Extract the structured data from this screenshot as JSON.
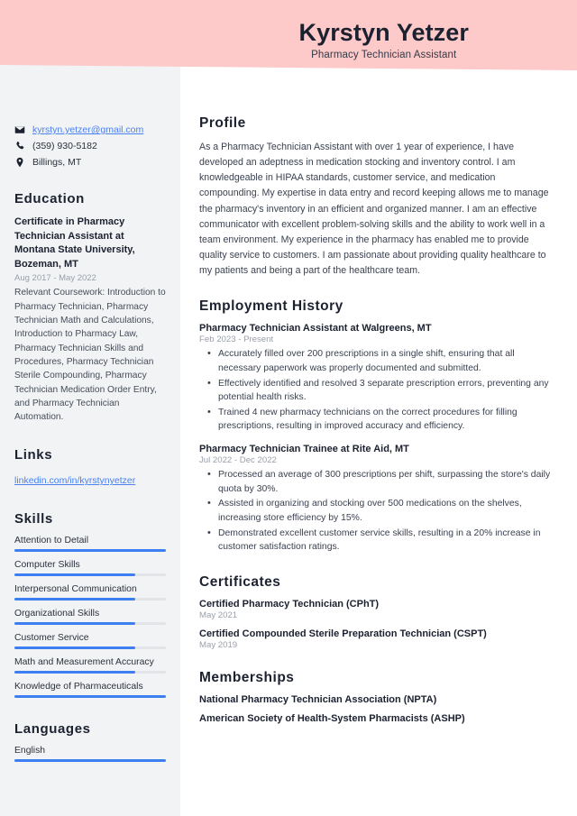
{
  "theme": {
    "banner_color": "#fdc9c9",
    "sidebar_color": "#f1f3f5",
    "accent_color": "#3d7ff0",
    "link_color": "#4a80f0"
  },
  "header": {
    "name": "Kyrstyn Yetzer",
    "job_title": "Pharmacy Technician Assistant"
  },
  "contact": {
    "email": "kyrstyn.yetzer@gmail.com",
    "phone": "(359) 930-5182",
    "location": "Billings, MT"
  },
  "education": {
    "heading": "Education",
    "entries": [
      {
        "title": "Certificate in Pharmacy Technician Assistant at Montana State University, Bozeman, MT",
        "date": "Aug 2017 - May 2022",
        "description": "Relevant Coursework: Introduction to Pharmacy Technician, Pharmacy Technician Math and Calculations, Introduction to Pharmacy Law, Pharmacy Technician Skills and Procedures, Pharmacy Technician Sterile Compounding, Pharmacy Technician Medication Order Entry, and Pharmacy Technician Automation."
      }
    ]
  },
  "links": {
    "heading": "Links",
    "items": [
      {
        "label": "linkedin.com/in/kyrstynyetzer"
      }
    ]
  },
  "skills": {
    "heading": "Skills",
    "items": [
      {
        "label": "Attention to Detail",
        "level": 100
      },
      {
        "label": "Computer Skills",
        "level": 80
      },
      {
        "label": "Interpersonal Communication",
        "level": 80
      },
      {
        "label": "Organizational Skills",
        "level": 80
      },
      {
        "label": "Customer Service",
        "level": 80
      },
      {
        "label": "Math and Measurement Accuracy",
        "level": 80
      },
      {
        "label": "Knowledge of Pharmaceuticals",
        "level": 100
      }
    ]
  },
  "languages": {
    "heading": "Languages",
    "items": [
      {
        "label": "English",
        "level": 100
      }
    ]
  },
  "profile": {
    "heading": "Profile",
    "text": "As a Pharmacy Technician Assistant with over 1 year of experience, I have developed an adeptness in medication stocking and inventory control. I am knowledgeable in HIPAA standards, customer service, and medication compounding. My expertise in data entry and record keeping allows me to manage the pharmacy's inventory in an efficient and organized manner. I am an effective communicator with excellent problem-solving skills and the ability to work well in a team environment. My experience in the pharmacy has enabled me to provide quality service to customers. I am passionate about providing quality healthcare to my patients and being a part of the healthcare team."
  },
  "employment": {
    "heading": "Employment History",
    "jobs": [
      {
        "title": "Pharmacy Technician Assistant at Walgreens, MT",
        "date": "Feb 2023 - Present",
        "bullets": [
          "Accurately filled over 200 prescriptions in a single shift, ensuring that all necessary paperwork was properly documented and submitted.",
          "Effectively identified and resolved 3 separate prescription errors, preventing any potential health risks.",
          "Trained 4 new pharmacy technicians on the correct procedures for filling prescriptions, resulting in improved accuracy and efficiency."
        ]
      },
      {
        "title": "Pharmacy Technician Trainee at Rite Aid, MT",
        "date": "Jul 2022 - Dec 2022",
        "bullets": [
          "Processed an average of 300 prescriptions per shift, surpassing the store's daily quota by 30%.",
          "Assisted in organizing and stocking over 500 medications on the shelves, increasing store efficiency by 15%.",
          "Demonstrated excellent customer service skills, resulting in a 20% increase in customer satisfaction ratings."
        ]
      }
    ]
  },
  "certificates": {
    "heading": "Certificates",
    "items": [
      {
        "title": "Certified Pharmacy Technician (CPhT)",
        "date": "May 2021"
      },
      {
        "title": "Certified Compounded Sterile Preparation Technician (CSPT)",
        "date": "May 2019"
      }
    ]
  },
  "memberships": {
    "heading": "Memberships",
    "items": [
      {
        "title": "National Pharmacy Technician Association (NPTA)"
      },
      {
        "title": "American Society of Health-System Pharmacists (ASHP)"
      }
    ]
  }
}
